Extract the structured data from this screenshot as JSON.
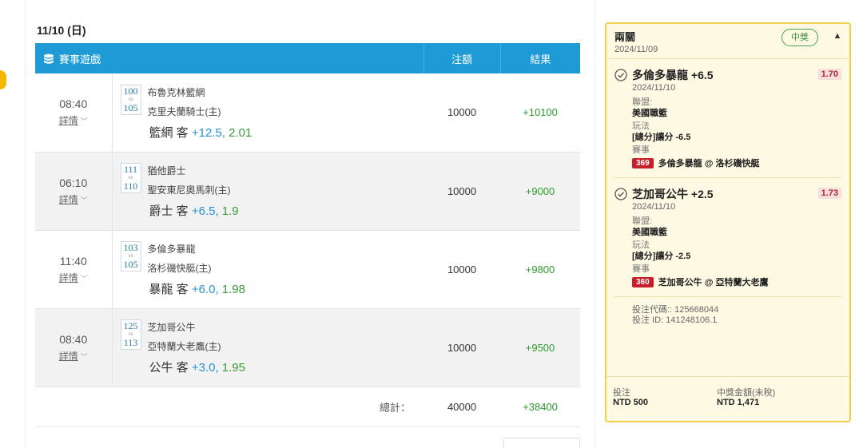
{
  "bets": {
    "date": "11/10 (日)",
    "columns": {
      "game": "賽事遊戲",
      "stake": "注額",
      "result": "結果"
    },
    "rows": [
      {
        "time": "08:40",
        "details": "詳情",
        "home_no": "100",
        "away_no": "105",
        "vs": "vs",
        "team1": "布魯克林籃網",
        "team2": "克里夫蘭騎士(主)",
        "pick_team": "籃網 客",
        "handicap": "+12.5,",
        "odds": "2.01",
        "stake": "10000",
        "result": "+10100"
      },
      {
        "time": "06:10",
        "details": "詳情",
        "home_no": "111",
        "away_no": "110",
        "vs": "vs",
        "team1": "猶他爵士",
        "team2": "聖安東尼奧馬刺(主)",
        "pick_team": "爵士 客",
        "handicap": "+6.5,",
        "odds": "1.9",
        "stake": "10000",
        "result": "+9000"
      },
      {
        "time": "11:40",
        "details": "詳情",
        "home_no": "103",
        "away_no": "105",
        "vs": "vs",
        "team1": "多倫多暴龍",
        "team2": "洛杉磯快艇(主)",
        "pick_team": "暴龍 客",
        "handicap": "+6.0,",
        "odds": "1.98",
        "stake": "10000",
        "result": "+9800"
      },
      {
        "time": "08:40",
        "details": "詳情",
        "home_no": "125",
        "away_no": "113",
        "vs": "vs",
        "team1": "芝加哥公牛",
        "team2": "亞特蘭大老鷹(主)",
        "pick_team": "公牛 客",
        "handicap": "+3.0,",
        "odds": "1.95",
        "stake": "10000",
        "result": "+9500"
      }
    ],
    "total": {
      "label": "總計：",
      "stake": "40000",
      "result": "+38400"
    }
  },
  "ticket": {
    "title": "兩關",
    "date": "2024/11/09",
    "badge": "中獎",
    "legs": [
      {
        "selection": "多倫多暴龍 +6.5",
        "date": "2024/11/10",
        "odds": "1.70",
        "league_label": "聯盟:",
        "league": "美國職籃",
        "market_label": "玩法",
        "market": "[總分]讓分 -6.5",
        "event_label": "賽事",
        "event_id": "369",
        "event": "多倫多暴龍 @ 洛杉磯快艇"
      },
      {
        "selection": "芝加哥公牛 +2.5",
        "date": "2024/11/10",
        "odds": "1.73",
        "league_label": "聯盟:",
        "league": "美國職籃",
        "market_label": "玩法",
        "market": "[總分]讓分 -2.5",
        "event_label": "賽事",
        "event_id": "360",
        "event": "芝加哥公牛 @ 亞特蘭大老鷹"
      }
    ],
    "bet_code": "投注代碼:: 125668044",
    "bet_id": "投注 ID: 141248106.1",
    "stake_label": "投注",
    "stake": "NTD 500",
    "payout_label": "中獎金額(未稅)",
    "payout": "NTD 1,471"
  },
  "colors": {
    "header_blue": "#1e9bd7",
    "win_green": "#2e9b2e",
    "card_border": "#f2d04b",
    "event_red": "#c8202a"
  },
  "icons": {
    "game": "database-icon",
    "check": "check-circle-icon",
    "collapse": "chevron-up-icon",
    "details": "chevron-down-icon"
  }
}
